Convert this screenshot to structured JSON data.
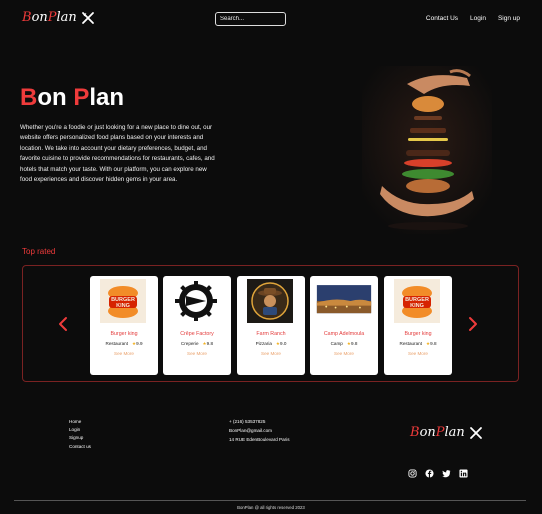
{
  "header": {
    "logo": {
      "first": "B",
      "mid": "on",
      "second": "P",
      "rest": "lan"
    },
    "search_placeholder": "Search...",
    "nav": {
      "contact": "Contact Us",
      "login": "Login",
      "signup": "Sign up"
    }
  },
  "hero": {
    "title_b": "B",
    "title_on": "on ",
    "title_p": "P",
    "title_lan": "lan",
    "description": "Whether you're a foodie or just looking for a new place to dine out, our website offers personalized food plans based on your interests and location. We take into account your dietary preferences, budget, and favorite cuisine to provide recommendations for restaurants, cafes, and hotels that match your taste. With our platform, you can explore new food experiences and discover hidden gems in your area."
  },
  "top_rated": {
    "title": "Top rated",
    "cards": [
      {
        "name": "Burger king",
        "category": "Restaurant",
        "rating": "9.9",
        "more": "See More",
        "image": "burger-king-logo"
      },
      {
        "name": "Crêpe Factory",
        "category": "Creperie",
        "rating": "9.8",
        "more": "See More",
        "image": "crepe-factory-logo"
      },
      {
        "name": "Farm Ranch",
        "category": "Pizzaria",
        "rating": "9.0",
        "more": "See More",
        "image": "farm-ranch-logo"
      },
      {
        "name": "Camp Adelmoula",
        "category": "Camp",
        "rating": "9.8",
        "more": "See More",
        "image": "camp-photo"
      },
      {
        "name": "Burger king",
        "category": "Restaurant",
        "rating": "9.8",
        "more": "See More",
        "image": "burger-king-logo"
      }
    ]
  },
  "footer": {
    "links": [
      "Home",
      "Login",
      "Signup",
      "Contact us"
    ],
    "phone": "+ (216) 53537825",
    "email": "BonPlan@gmail.com",
    "address": "14 RUE EdenBoulevard Paris",
    "socials": [
      "instagram-icon",
      "facebook-icon",
      "twitter-icon",
      "linkedin-icon"
    ],
    "copyright": "BonPlan @ all rights reserved 2023"
  },
  "colors": {
    "accent": "#ef3b3b",
    "background": "#0c0c0c",
    "card_border": "#7a2222"
  }
}
